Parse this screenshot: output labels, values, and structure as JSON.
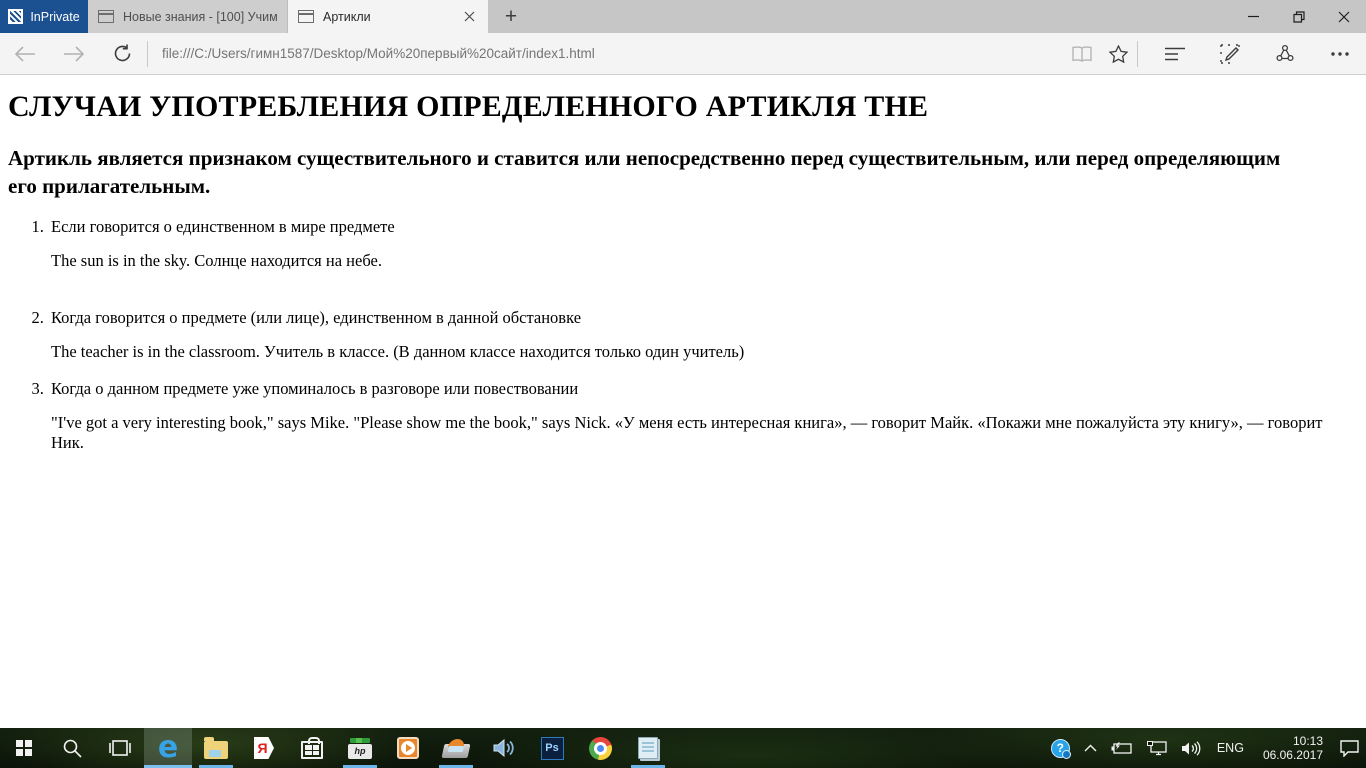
{
  "tabbar": {
    "inprivate_label": "InPrivate",
    "tabs": [
      {
        "title": "Новые знания - [100] Учим"
      },
      {
        "title": "Артикли"
      }
    ],
    "new_tab_glyph": "+"
  },
  "toolbar": {
    "url": "file:///C:/Users/гимн1587/Desktop/Мой%20первый%20сайт/index1.html"
  },
  "page": {
    "heading": "СЛУЧАИ УПОТРЕБЛЕНИЯ ОПРЕДЕЛЕННОГО АРТИКЛЯ THE",
    "intro": "Артикль является признаком существительного и ставится или непосредственно перед существительным, или перед определяющим его прилагательным.",
    "rules": [
      {
        "rule": "Если говорится о единственном в мире предмете",
        "example": "The sun is in the sky. Солнце находится на небе."
      },
      {
        "rule": "Когда говорится о предмете (или лице), единственном в данной обстановке",
        "example": "The teacher is in the classroom. Учитель в классе. (В данном классе находится только один учитель)"
      },
      {
        "rule": "Когда о данном предмете уже упоминалось в разговоре или повествовании",
        "example": "\"I've got a very interesting book,\" says Mike. \"Please show me the book,\" says Nick. «У меня есть интересная книга», — говорит Майк. «Покажи мне пожалуйста эту книгу», — говорит Ник."
      }
    ]
  },
  "taskbar": {
    "language": "ENG",
    "time": "10:13",
    "date": "06.06.2017",
    "hp_label": "hp",
    "ps_label": "Ps",
    "yandex_label": "Я"
  },
  "colors": {
    "inprivate_badge": "#1c5191",
    "taskbar_underline": "#6cb5e8",
    "edge_blue": "#37a3e6"
  }
}
